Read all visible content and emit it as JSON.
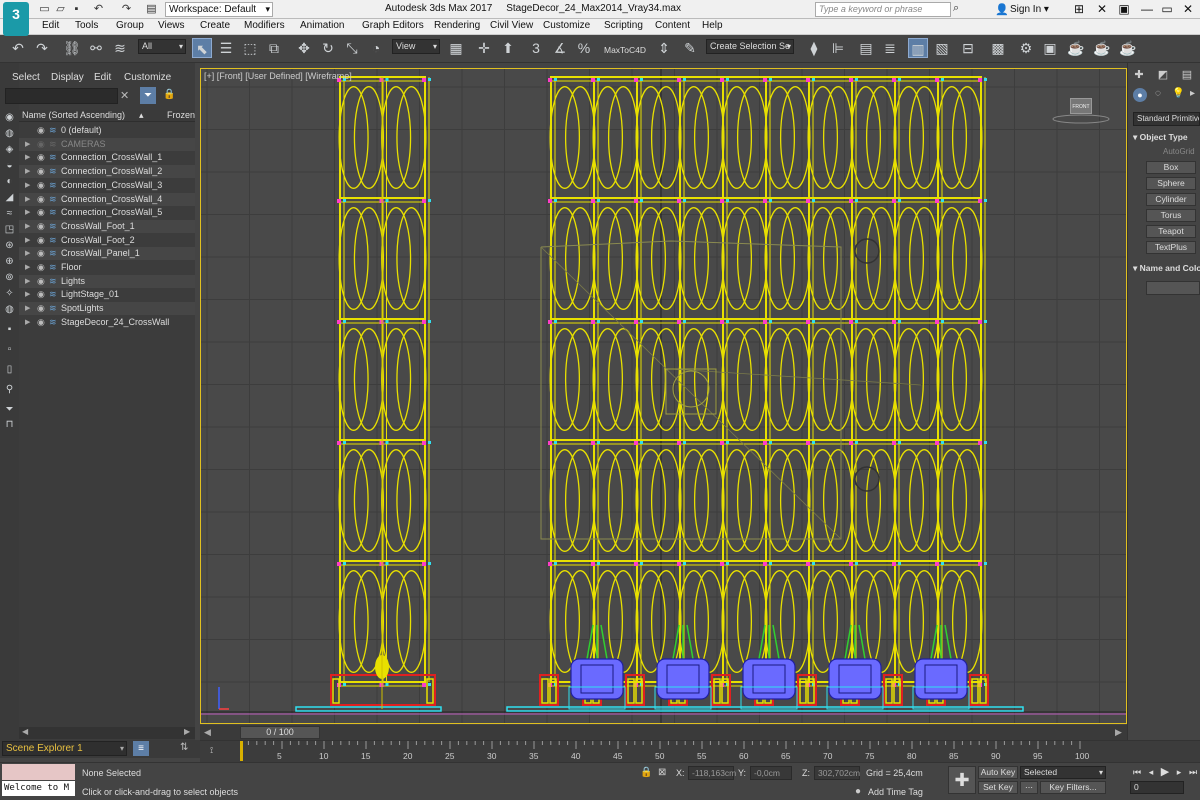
{
  "titlebar": {
    "logo": "3",
    "workspace": "Workspace: Default",
    "title": "Autodesk 3ds Max 2017",
    "file": "StageDecor_24_Max2014_Vray34.max",
    "search_placeholder": "Type a keyword or phrase",
    "signin": "Sign In"
  },
  "menu": [
    "Edit",
    "Tools",
    "Group",
    "Views",
    "Create",
    "Modifiers",
    "Animation",
    "Graph Editors",
    "Rendering",
    "Civil View",
    "Customize",
    "Scripting",
    "Content",
    "Help"
  ],
  "toolbar": {
    "filter": "All",
    "refcoord": "View",
    "maxtoc4d": "MaxToC4D",
    "selection_set": "Create Selection Se"
  },
  "scene_explorer": {
    "tabs": [
      "Select",
      "Display",
      "Edit",
      "Customize"
    ],
    "col_name": "Name (Sorted Ascending)",
    "col_frozen": "Frozen",
    "items": [
      "0 (default)",
      "CAMERAS",
      "Connection_CrossWall_1",
      "Connection_CrossWall_2",
      "Connection_CrossWall_3",
      "Connection_CrossWall_4",
      "Connection_CrossWall_5",
      "CrossWall_Foot_1",
      "CrossWall_Foot_2",
      "CrossWall_Panel_1",
      "Floor",
      "Lights",
      "LightStage_01",
      "SpotLights",
      "StageDecor_24_CrossWall"
    ],
    "selector": "Scene Explorer 1"
  },
  "viewport": {
    "label": "[+] [Front] [User Defined] [Wireframe]",
    "viewcube": "FRONT"
  },
  "command_panel": {
    "category": "Standard Primitives",
    "object_type": "Object Type",
    "autogrid": "AutoGrid",
    "buttons": [
      "Box",
      "Sphere",
      "Cylinder",
      "Torus",
      "Teapot",
      "TextPlus"
    ],
    "name_color": "Name and Color"
  },
  "timeline": {
    "position": "0 / 100",
    "ticks": [
      "0",
      "5",
      "10",
      "15",
      "20",
      "25",
      "30",
      "35",
      "40",
      "45",
      "50",
      "55",
      "60",
      "65",
      "70",
      "75",
      "80",
      "85",
      "90",
      "95",
      "100"
    ]
  },
  "status": {
    "welcome": "Welcome to M",
    "selection": "None Selected",
    "prompt": "Click or click-and-drag to select objects",
    "x_label": "X:",
    "x": "-118,163cm",
    "y_label": "Y:",
    "y": "-0,0cm",
    "z_label": "Z:",
    "z": "302,702cm",
    "grid": "Grid = 25,4cm",
    "add_time_tag": "Add Time Tag",
    "autokey": "Auto Key",
    "selected": "Selected",
    "setkey": "Set Key",
    "keyfilters": "Key Filters...",
    "frame": "0"
  },
  "colors": {
    "wire_yellow": "#e8e000",
    "connection_magenta": "#ff3cc8",
    "cyan": "#30e0f0",
    "red": "#e02020",
    "blue_lights": "#6a6aff",
    "green": "#30d030",
    "selection_highlight": "#5d7ea6"
  }
}
